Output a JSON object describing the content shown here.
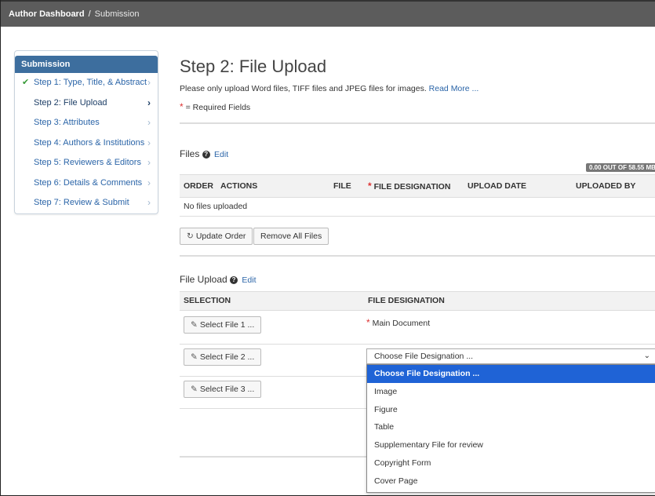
{
  "topbar": {
    "dashboard": "Author Dashboard",
    "separator": "/",
    "current": "Submission"
  },
  "sidebar": {
    "heading": "Submission",
    "items": [
      {
        "label": "Step 1: Type, Title, & Abstract",
        "completed": true,
        "active": false
      },
      {
        "label": "Step 2: File Upload",
        "completed": false,
        "active": true
      },
      {
        "label": "Step 3: Attributes",
        "completed": false,
        "active": false
      },
      {
        "label": "Step 4: Authors & Institutions",
        "completed": false,
        "active": false
      },
      {
        "label": "Step 5: Reviewers & Editors",
        "completed": false,
        "active": false
      },
      {
        "label": "Step 6: Details & Comments",
        "completed": false,
        "active": false
      },
      {
        "label": "Step 7: Review & Submit",
        "completed": false,
        "active": false
      }
    ]
  },
  "main": {
    "title": "Step 2: File Upload",
    "intro": "Please only upload Word files, TIFF files and JPEG files for images.",
    "read_more": "Read More ...",
    "required_star": "*",
    "required_text": "= Required Fields"
  },
  "files": {
    "title": "Files",
    "edit": "Edit",
    "quota": "0.00 OUT OF 58.55 MB",
    "headers": {
      "order": "ORDER",
      "actions": "ACTIONS",
      "file": "FILE",
      "designation": "FILE DESIGNATION",
      "upload_date": "UPLOAD DATE",
      "uploaded_by": "UPLOADED BY"
    },
    "empty": "No files uploaded",
    "update_order": "Update Order",
    "remove_all": "Remove All Files"
  },
  "file_upload": {
    "title": "File Upload",
    "edit": "Edit",
    "headers": {
      "selection": "SELECTION",
      "designation": "FILE DESIGNATION"
    },
    "select_1": "Select File 1 ...",
    "select_2": "Select File 2 ...",
    "select_3": "Select File 3 ...",
    "main_document": "Main Document",
    "select_value": "Choose File Designation ...",
    "options": [
      "Choose File Designation ...",
      "Image",
      "Figure",
      "Table",
      "Supplementary File for review",
      "Copyright Form",
      "Cover Page"
    ],
    "selected_index": 0
  },
  "icons": {
    "check": "check-icon",
    "chevron": "chevron-right-icon",
    "help": "question-circle-icon",
    "refresh": "refresh-icon",
    "paperclip": "paperclip-icon",
    "caret": "caret-down-icon"
  },
  "colors": {
    "topbar": "#5c5c5c",
    "sidebar_header": "#3d6e9e",
    "link": "#2b65a8",
    "selected_option": "#1f63d6",
    "required": "#dd3333",
    "completed": "#3a9b3a"
  }
}
